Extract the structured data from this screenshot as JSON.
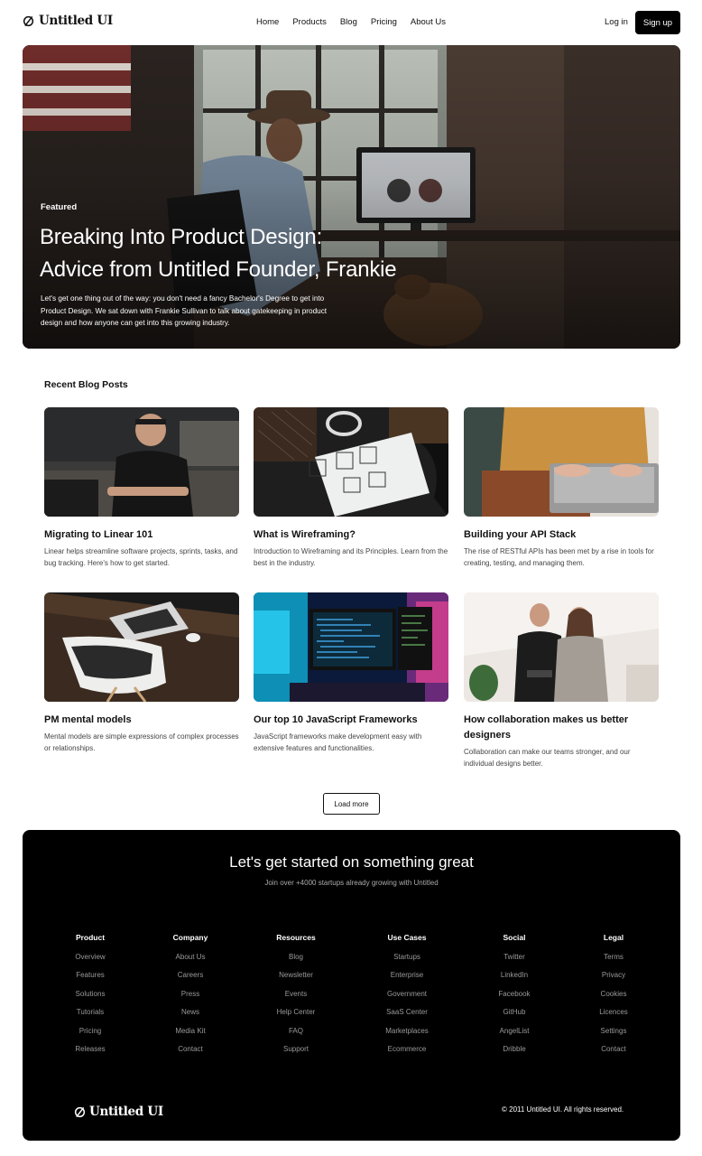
{
  "brand": {
    "name": "Untitled UI"
  },
  "nav": {
    "links": [
      "Home",
      "Products",
      "Blog",
      "Pricing",
      "About Us"
    ],
    "login": "Log in",
    "signup": "Sign up"
  },
  "hero": {
    "tag": "Featured",
    "title_line1": "Breaking Into Product Design:",
    "title_line2": "Advice from Untitled Founder, Frankie",
    "description": "Let's get one thing out of the way: you don't need a fancy Bachelor's Degree to get into Product Design. We sat down with Frankie Sullivan to talk about gatekeeping in product design and how anyone can get into this growing industry."
  },
  "posts": {
    "section_title": "Recent Blog Posts",
    "items": [
      {
        "title": "Migrating to Linear 101",
        "desc": "Linear helps streamline software projects, sprints, tasks, and bug tracking. Here's how to get started."
      },
      {
        "title": "What is Wireframing?",
        "desc": "Introduction to Wireframing and its Principles. Learn from the best in the industry."
      },
      {
        "title": "Building your API Stack",
        "desc": "The rise of RESTful APIs has been met by a rise in tools for creating, testing, and managing them."
      },
      {
        "title": "PM mental models",
        "desc": "Mental models are simple expressions of complex processes or relationships."
      },
      {
        "title": "Our top 10 JavaScript Frameworks",
        "desc": "JavaScript frameworks make development easy with extensive features and functionalities."
      },
      {
        "title": "How collaboration makes us better designers",
        "desc": "Collaboration can make our teams stronger, and our individual designs better."
      }
    ],
    "load_more": "Load more"
  },
  "footer": {
    "cta_title": "Let's get started on something great",
    "cta_subtitle": "Join over +4000 startups already growing with Untitled",
    "columns": [
      {
        "heading": "Product",
        "items": [
          "Overview",
          "Features",
          "Solutions",
          "Tutorials",
          "Pricing",
          "Releases"
        ]
      },
      {
        "heading": "Company",
        "items": [
          "About Us",
          "Careers",
          "Press",
          "News",
          "Media Kit",
          "Contact"
        ]
      },
      {
        "heading": "Resources",
        "items": [
          "Blog",
          "Newsletter",
          "Events",
          "Help Center",
          "FAQ",
          "Support"
        ]
      },
      {
        "heading": "Use Cases",
        "items": [
          "Startups",
          "Enterprise",
          "Government",
          "SaaS Center",
          "Marketplaces",
          "Ecommerce"
        ]
      },
      {
        "heading": "Social",
        "items": [
          "Twitter",
          "LinkedIn",
          "Facebook",
          "GitHub",
          "AngelList",
          "Dribble"
        ]
      },
      {
        "heading": "Legal",
        "items": [
          "Terms",
          "Privacy",
          "Cookies",
          "Licences",
          "Settings",
          "Contact"
        ]
      }
    ],
    "copyright": "© 2011 Untitled UI. All rights reserved."
  }
}
